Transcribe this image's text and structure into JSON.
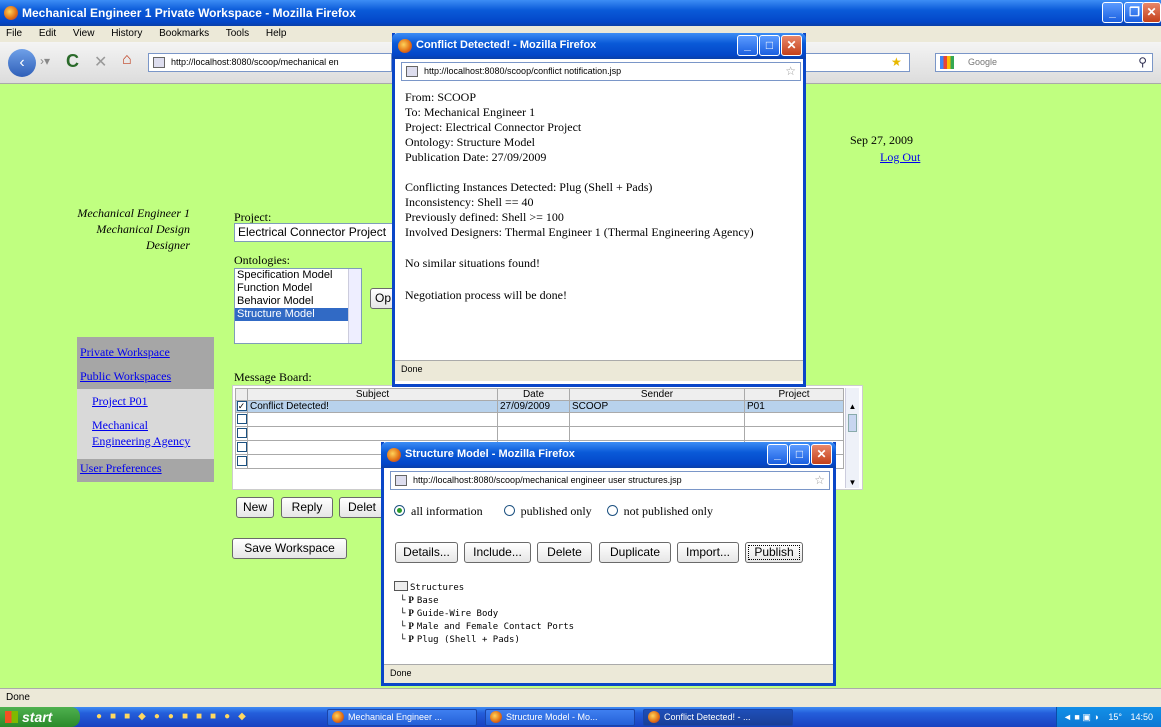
{
  "main_window": {
    "title": "Mechanical Engineer 1 Private Workspace - Mozilla Firefox",
    "menu": [
      "File",
      "Edit",
      "View",
      "History",
      "Bookmarks",
      "Tools",
      "Help"
    ],
    "url": "http://localhost:8080/scoop/mechanical en",
    "search_placeholder": "Google",
    "status": "Done"
  },
  "page": {
    "user_name": "Mechanical Engineer 1",
    "user_dept": "Mechanical Design",
    "user_role": "Designer",
    "date": "Sep 27, 2009",
    "logout": "Log Out",
    "project_label": "Project:",
    "project_value": "Electrical Connector Project",
    "ontologies_label": "Ontologies:",
    "ontologies": [
      "Specification Model",
      "Function Model",
      "Behavior Model",
      "Structure Model"
    ],
    "ontologies_selected": "Structure Model",
    "open_button": "Op",
    "nav": {
      "private": "Private Workspace",
      "public": "Public Workspaces",
      "project_p01": "Project P01",
      "agency_line1": "Mechanical",
      "agency_line2": "Engineering Agency",
      "prefs": "User Preferences"
    },
    "message_board_label": "Message Board:",
    "table_headers": [
      "Subject",
      "Date",
      "Sender",
      "Project"
    ],
    "table_rows": [
      {
        "subject": "Conflict Detected!",
        "date": "27/09/2009",
        "sender": "SCOOP",
        "project": "P01"
      }
    ],
    "buttons": {
      "new": "New",
      "reply": "Reply",
      "delete": "Delet",
      "save_workspace": "Save Workspace"
    }
  },
  "conflict_popup": {
    "title": "Conflict Detected! - Mozilla Firefox",
    "url": "http://localhost:8080/scoop/conflict notification.jsp",
    "lines": [
      "From: SCOOP",
      "To: Mechanical Engineer 1",
      "Project: Electrical Connector Project",
      "Ontology: Structure Model",
      "Publication Date: 27/09/2009"
    ],
    "lines2": [
      "Conflicting Instances Detected: Plug (Shell + Pads)",
      "Inconsistency: Shell == 40",
      "Previously defined: Shell >= 100",
      "Involved Designers: Thermal Engineer 1 (Thermal Engineering Agency)"
    ],
    "no_similar": "No similar situations found!",
    "negotiation": "Negotiation process will be done!",
    "status": "Done"
  },
  "structure_popup": {
    "title": "Structure Model - Mozilla Firefox",
    "url": "http://localhost:8080/scoop/mechanical engineer user structures.jsp",
    "radio_all": "all information",
    "radio_published": "published only",
    "radio_not_published": "not published only",
    "buttons": {
      "details": "Details...",
      "include": "Include...",
      "delete": "Delete",
      "duplicate": "Duplicate",
      "import": "Import...",
      "publish": "Publish"
    },
    "tree_root": "Structures",
    "tree_items": [
      "Base",
      "Guide-Wire Body",
      "Male and Female Contact Ports",
      "Plug (Shell + Pads)"
    ],
    "tree_marker": "P",
    "status": "Done"
  },
  "taskbar": {
    "start": "start",
    "tasks": [
      "Mechanical Engineer ...",
      "Structure Model - Mo...",
      "Conflict Detected! - ..."
    ],
    "tray_temp": "15°",
    "time": "14:50"
  }
}
